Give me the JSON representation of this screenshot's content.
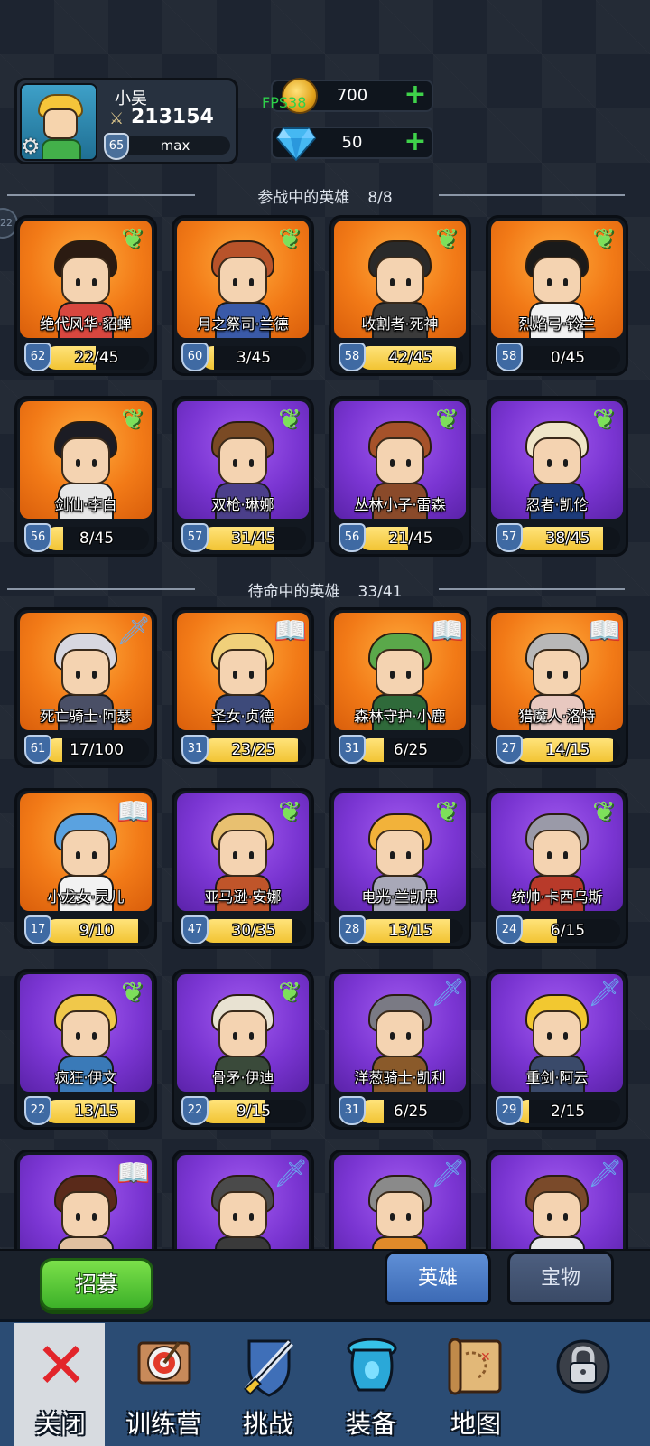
{
  "player": {
    "name": "小吴",
    "power": "213154",
    "level": "65",
    "xp_label": "max"
  },
  "resources": {
    "fps": "FPS38",
    "gold": "700",
    "gems": "50"
  },
  "side_bubble": "22",
  "sections": {
    "active": {
      "title": "参战中的英雄",
      "count": "8/8"
    },
    "standby": {
      "title": "待命中的英雄",
      "count": "33/41"
    }
  },
  "active_heroes": [
    {
      "name": "绝代风华·貂蝉",
      "level": "62",
      "progress": "22/45",
      "ratio": 0.49,
      "bg": "orange",
      "badge": "wing",
      "hair": "#2b1b12",
      "outfit": "#d8473f"
    },
    {
      "name": "月之祭司·兰德",
      "level": "60",
      "progress": "3/45",
      "ratio": 0.07,
      "bg": "orange",
      "badge": "wing",
      "hair": "#b8532a",
      "outfit": "#3a5aa8"
    },
    {
      "name": "收割者·死神",
      "level": "58",
      "progress": "42/45",
      "ratio": 0.93,
      "bg": "orange",
      "badge": "wing",
      "hair": "#2a2a2a",
      "outfit": "#3a3a3a"
    },
    {
      "name": "烈焰弓·铃兰",
      "level": "58",
      "progress": "0/45",
      "ratio": 0.0,
      "bg": "orange",
      "badge": "wing",
      "hair": "#1a1a1a",
      "outfit": "#f2f2f2"
    },
    {
      "name": "剑仙·李白",
      "level": "56",
      "progress": "8/45",
      "ratio": 0.18,
      "bg": "orange",
      "badge": "wing",
      "hair": "#1c1c24",
      "outfit": "#e7e7e7"
    },
    {
      "name": "双枪·琳娜",
      "level": "57",
      "progress": "31/45",
      "ratio": 0.69,
      "bg": "purple",
      "badge": "wing",
      "hair": "#7a4a24",
      "outfit": "#4b3f8a"
    },
    {
      "name": "丛林小子·雷森",
      "level": "56",
      "progress": "21/45",
      "ratio": 0.47,
      "bg": "purple",
      "badge": "wing",
      "hair": "#a6522a",
      "outfit": "#8a4a2a"
    },
    {
      "name": "忍者·凯伦",
      "level": "57",
      "progress": "38/45",
      "ratio": 0.84,
      "bg": "purple",
      "badge": "wing",
      "hair": "#f0e6c8",
      "outfit": "#1d3b7a"
    }
  ],
  "standby_heroes": [
    {
      "name": "死亡骑士·阿瑟",
      "level": "61",
      "progress": "17/100",
      "ratio": 0.17,
      "bg": "orange",
      "badge": "sword",
      "hair": "#d7d7e0",
      "outfit": "#4a4f66"
    },
    {
      "name": "圣女·贞德",
      "level": "31",
      "progress": "23/25",
      "ratio": 0.92,
      "bg": "orange",
      "badge": "book",
      "hair": "#f0d07a",
      "outfit": "#3d4a7a"
    },
    {
      "name": "森林守护·小鹿",
      "level": "31",
      "progress": "6/25",
      "ratio": 0.24,
      "bg": "orange",
      "badge": "book",
      "hair": "#5aa84a",
      "outfit": "#2f6a3a"
    },
    {
      "name": "猎魔人·洛特",
      "level": "27",
      "progress": "14/15",
      "ratio": 0.93,
      "bg": "orange",
      "badge": "book",
      "hair": "#b8b8b8",
      "outfit": "#e8c8c0"
    },
    {
      "name": "小龙女·灵儿",
      "level": "17",
      "progress": "9/10",
      "ratio": 0.9,
      "bg": "orange",
      "badge": "book",
      "hair": "#5aa2e0",
      "outfit": "#f2f2f2"
    },
    {
      "name": "亚马逊·安娜",
      "level": "47",
      "progress": "30/35",
      "ratio": 0.86,
      "bg": "purple",
      "badge": "wing",
      "hair": "#e8c070",
      "outfit": "#c0552a"
    },
    {
      "name": "电光·兰凯思",
      "level": "28",
      "progress": "13/15",
      "ratio": 0.87,
      "bg": "purple",
      "badge": "wing",
      "hair": "#f2b23a",
      "outfit": "#a8a8b8"
    },
    {
      "name": "统帅·卡西乌斯",
      "level": "24",
      "progress": "6/15",
      "ratio": 0.4,
      "bg": "purple",
      "badge": "wing",
      "hair": "#9a9aa8",
      "outfit": "#b83a2a"
    },
    {
      "name": "疯狂·伊文",
      "level": "22",
      "progress": "13/15",
      "ratio": 0.87,
      "bg": "purple",
      "badge": "wing",
      "hair": "#f0c84a",
      "outfit": "#3a7ab8"
    },
    {
      "name": "骨矛·伊迪",
      "level": "22",
      "progress": "9/15",
      "ratio": 0.6,
      "bg": "purple",
      "badge": "wing",
      "hair": "#e8e2d2",
      "outfit": "#3a4a3a"
    },
    {
      "name": "洋葱骑士·凯利",
      "level": "31",
      "progress": "6/25",
      "ratio": 0.24,
      "bg": "purple",
      "badge": "sword",
      "hair": "#7a7a84",
      "outfit": "#8a5a2a"
    },
    {
      "name": "重剑·阿云",
      "level": "29",
      "progress": "2/15",
      "ratio": 0.13,
      "bg": "purple",
      "badge": "sword",
      "hair": "#f2c830",
      "outfit": "#3a4a6a"
    },
    {
      "name": "",
      "level": "",
      "progress": "",
      "ratio": 0,
      "bg": "purple",
      "badge": "book",
      "hair": "#5a2a1a",
      "outfit": "#e0c0a0"
    },
    {
      "name": "",
      "level": "",
      "progress": "",
      "ratio": 0,
      "bg": "purple",
      "badge": "sword",
      "hair": "#4a4a4a",
      "outfit": "#3a3a3a"
    },
    {
      "name": "",
      "level": "",
      "progress": "",
      "ratio": 0,
      "bg": "purple",
      "badge": "sword",
      "hair": "#8a8a8a",
      "outfit": "#e08a2a"
    },
    {
      "name": "",
      "level": "",
      "progress": "",
      "ratio": 0,
      "bg": "purple",
      "badge": "sword",
      "hair": "#7a4a2a",
      "outfit": "#e8e8e8"
    }
  ],
  "badge_icons": {
    "wing": "wing-icon",
    "sword": "sword-icon",
    "book": "book-icon"
  },
  "actions": {
    "recruit": "招募",
    "tab_heroes": "英雄",
    "tab_treasure": "宝物"
  },
  "nav": [
    {
      "label": "关闭",
      "icon": "close-icon"
    },
    {
      "label": "训练营",
      "icon": "training-target-icon"
    },
    {
      "label": "挑战",
      "icon": "sword-shield-icon"
    },
    {
      "label": "装备",
      "icon": "equipment-icon"
    },
    {
      "label": "地图",
      "icon": "map-icon"
    },
    {
      "label": "",
      "icon": "locked-icon"
    }
  ]
}
